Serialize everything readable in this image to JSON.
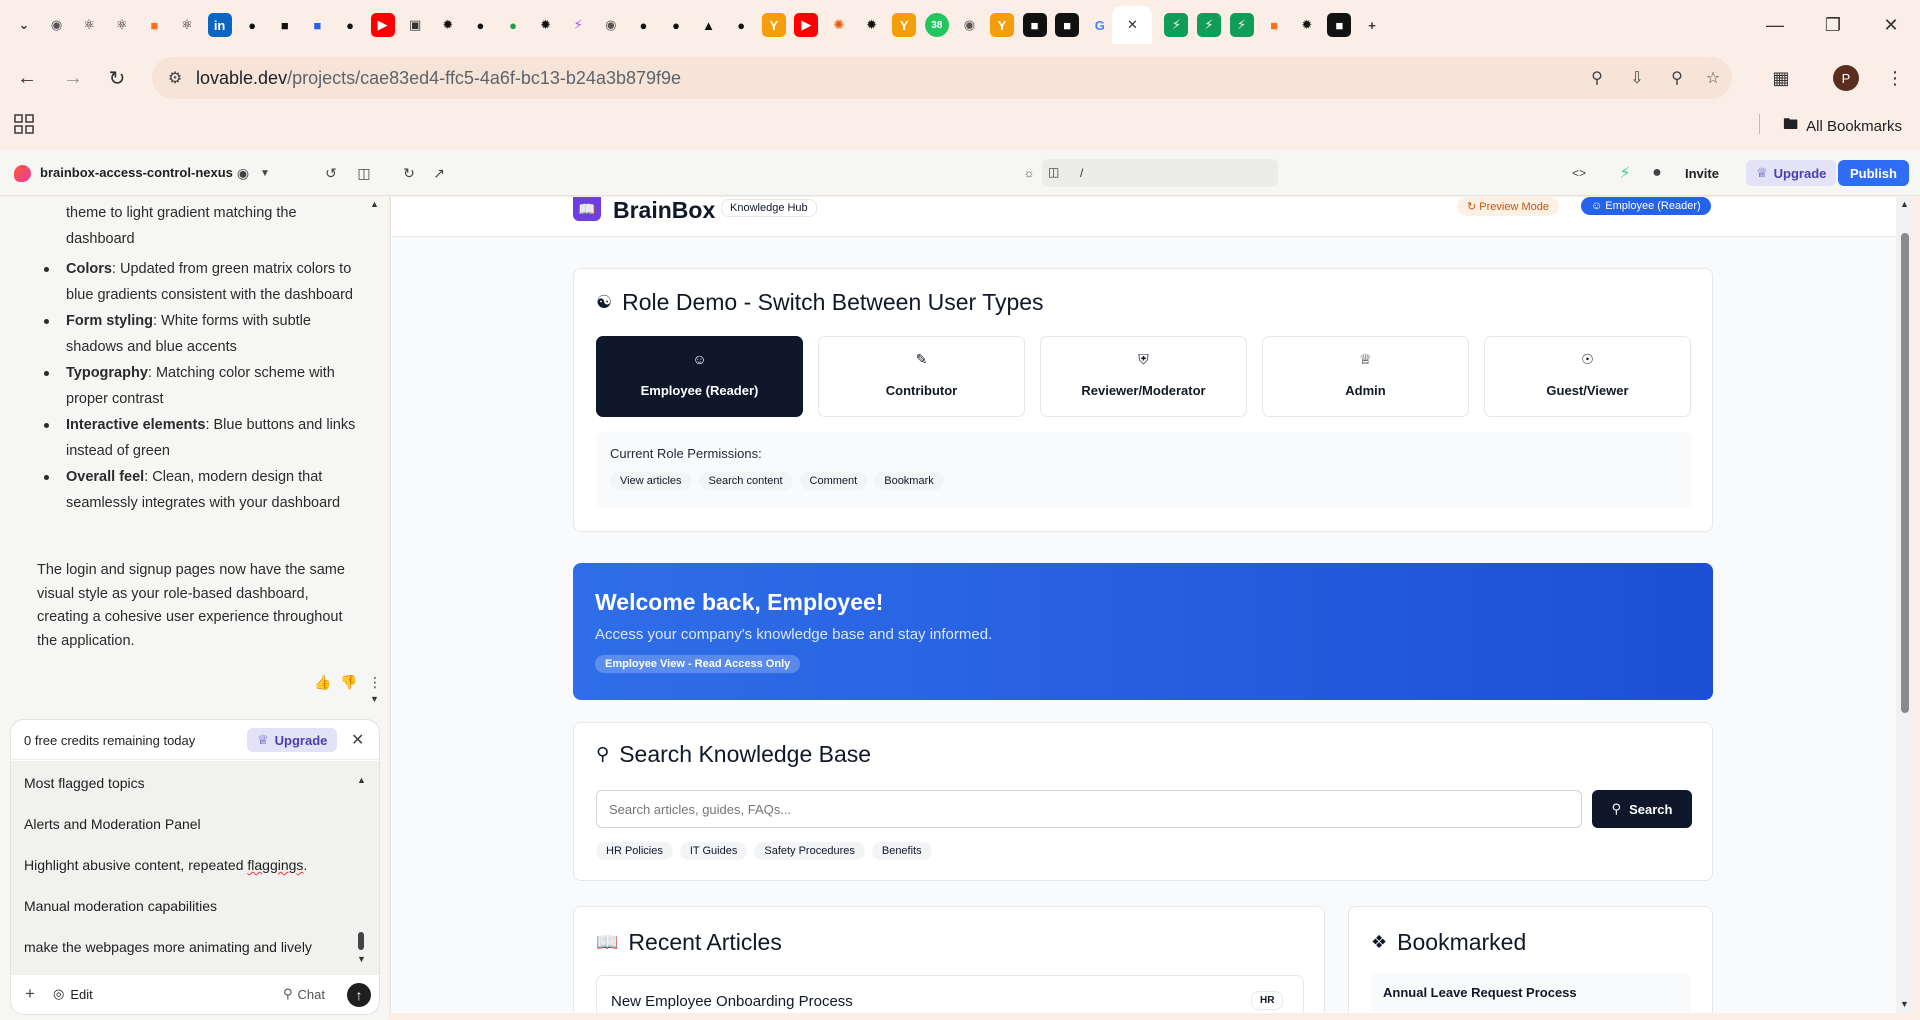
{
  "browser": {
    "tab_icons": [
      "chevron-down-icon",
      "globe-icon",
      "react-icon",
      "react-icon",
      "orange-logo-icon",
      "react-icon",
      "linkedin-icon",
      "github-icon",
      "dark-logo-icon",
      "blue-logo-icon",
      "github-icon",
      "youtube-icon",
      "image-icon",
      "openai-icon",
      "black-logo-icon",
      "green-logo-icon",
      "openai-icon",
      "purple-logo-icon",
      "globe-icon",
      "github-icon",
      "github-icon",
      "triangle-logo-icon",
      "github-icon",
      "y-logo-icon",
      "youtube-icon",
      "spark-icon",
      "openai-icon",
      "y-logo-icon",
      "green-badge-icon",
      "chrome-icon",
      "y-logo-icon",
      "vscode-icon",
      "vscode-icon",
      "google-icon",
      "close-icon",
      "bolt-icon",
      "bolt-icon",
      "bolt-icon",
      "orange-logo-icon",
      "openai-icon",
      "vscode-icon",
      "plus-icon"
    ],
    "tab_badge": "38",
    "url_host": "lovable.dev",
    "url_path": "/projects/cae83ed4-ffc5-4a6f-bc13-b24a3b879f9e",
    "bookmarks_label": "All Bookmarks",
    "profile_initial": "P"
  },
  "app": {
    "project_name": "brainbox-access-control-nexus",
    "route": "/",
    "invite_label": "Invite",
    "upgrade_label": "Upgrade",
    "publish_label": "Publish",
    "accent": "#2f6df6"
  },
  "chat": {
    "items": [
      {
        "bold": "",
        "text": "theme to light gradient matching the dashboard"
      },
      {
        "bold": "Colors",
        "text": ": Updated from green matrix colors to blue gradients consistent with the dashboard"
      },
      {
        "bold": "Form styling",
        "text": ": White forms with subtle shadows and blue accents"
      },
      {
        "bold": "Typography",
        "text": ": Matching color scheme with proper contrast"
      },
      {
        "bold": "Interactive elements",
        "text": ": Blue buttons and links instead of green"
      },
      {
        "bold": "Overall feel",
        "text": ": Clean, modern design that seamlessly integrates with your dashboard"
      }
    ],
    "summary": "The login and signup pages now have the same visual style as your role-based dashboard, creating a cohesive user experience throughout the application.",
    "credits_text": "0 free credits remaining today",
    "credits_upgrade": "Upgrade",
    "prompt_lines": [
      "Most flagged topics",
      "Alerts and Moderation Panel",
      "Highlight abusive content, repeated ",
      "Manual moderation capabilities",
      "make the webpages more animating and lively"
    ],
    "prompt_squiggle_word": "flaggings",
    "prompt_squiggle_tail": ".",
    "edit_label": "Edit",
    "chat_label": "Chat"
  },
  "site": {
    "brand": "BrainBox",
    "hub_badge": "Knowledge Hub",
    "preview_mode": "Preview Mode",
    "current_role_badge": "Employee (Reader)",
    "role_demo_title": "Role Demo - Switch Between User Types",
    "roles": [
      {
        "label": "Employee (Reader)",
        "icon": "user-icon",
        "active": true
      },
      {
        "label": "Contributor",
        "icon": "pencil-icon",
        "active": false
      },
      {
        "label": "Reviewer/Moderator",
        "icon": "shield-icon",
        "active": false
      },
      {
        "label": "Admin",
        "icon": "crown-icon",
        "active": false
      },
      {
        "label": "Guest/Viewer",
        "icon": "eye-icon",
        "active": false
      }
    ],
    "permissions_title": "Current Role Permissions:",
    "permissions": [
      "View articles",
      "Search content",
      "Comment",
      "Bookmark"
    ],
    "welcome_title": "Welcome back, Employee!",
    "welcome_sub": "Access your company's knowledge base and stay informed.",
    "welcome_badge": "Employee View - Read Access Only",
    "search_title": "Search Knowledge Base",
    "search_placeholder": "Search articles, guides, FAQs...",
    "search_button": "Search",
    "search_tags": [
      "HR Policies",
      "IT Guides",
      "Safety Procedures",
      "Benefits"
    ],
    "recent_title": "Recent Articles",
    "recent_article": "New Employee Onboarding Process",
    "recent_article_tag": "HR",
    "bookmarked_title": "Bookmarked",
    "bookmarked_item": "Annual Leave Request Process"
  }
}
